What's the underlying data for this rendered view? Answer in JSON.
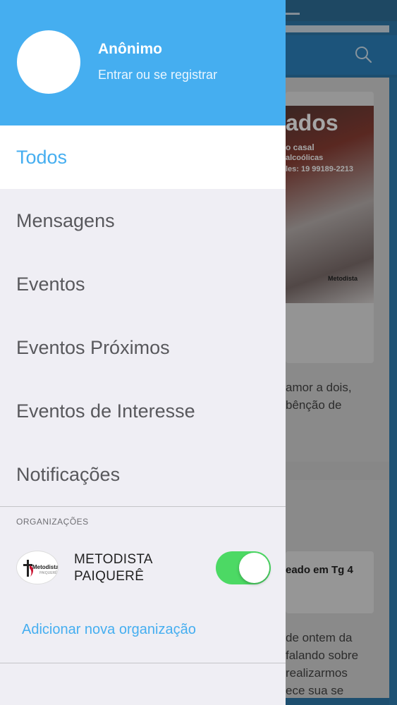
{
  "background": {
    "card_title_partial": "ados",
    "card_sub_lines": [
      "o casal",
      "alcoólicas",
      "les: 19 99189-2213"
    ],
    "card_logo_text": "Metodista",
    "text_lines_1": [
      "amor a dois,",
      "bênção de"
    ],
    "card2_text": "eado em Tg 4",
    "text_lines_2": [
      "de ontem da",
      "falando sobre",
      "realizarmos",
      "ece sua se"
    ]
  },
  "drawer": {
    "user": {
      "name": "Anônimo",
      "login_link": "Entrar ou se registrar"
    },
    "menu": [
      {
        "label": "Todos",
        "active": true
      },
      {
        "label": "Mensagens",
        "active": false
      },
      {
        "label": "Eventos",
        "active": false
      },
      {
        "label": "Eventos Próximos",
        "active": false
      },
      {
        "label": "Eventos de Interesse",
        "active": false
      },
      {
        "label": "Notificações",
        "active": false
      }
    ],
    "section_label": "ORGANIZAÇÕES",
    "organization": {
      "name_line1": "METODISTA",
      "name_line2": "PAIQUERÊ",
      "logo_text": "Metodista",
      "logo_subtext": "PAIQUERÊ",
      "enabled": true
    },
    "add_org_link": "Adicionar nova organização"
  },
  "colors": {
    "accent": "#45aef0",
    "toggle_on": "#4cd964",
    "menu_text": "#58585c",
    "drawer_bg": "#efeef4"
  },
  "icons": {
    "search": "search-icon",
    "org_logo": "methodist-cross-flame-icon"
  }
}
